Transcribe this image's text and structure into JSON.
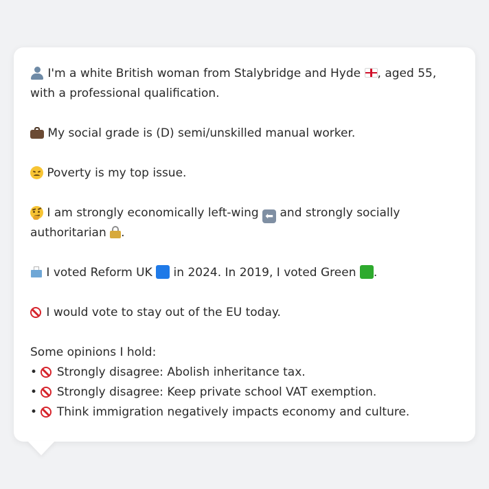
{
  "profile": {
    "intro_pre": "I'm a white British woman from Stalybridge and Hyde",
    "intro_post": ", aged 55, with a professional qualification.",
    "social_grade": "My social grade is (D) semi/unskilled manual worker.",
    "top_issue": "Poverty is my top issue.",
    "ideology_pre": "I am strongly economically left-wing",
    "ideology_mid": " and strongly socially authoritarian",
    "ideology_post": ".",
    "vote_pre": "I voted Reform UK",
    "vote_mid": " in 2024. In 2019, I voted Green",
    "vote_post": ".",
    "eu": "I would vote to stay out of the EU today.",
    "opinions_heading": "Some opinions I hold:",
    "opinions": [
      "Strongly disagree: Abolish inheritance tax.",
      "Strongly disagree: Keep private school VAT exemption.",
      "Think immigration negatively impacts economy and culture."
    ],
    "bullet": "•",
    "left_arrow_glyph": "⬅"
  },
  "icons": {
    "intro": "bust-in-silhouette-icon",
    "flag": "england-flag-icon",
    "grade": "briefcase-icon",
    "issue": "disappointed-face-icon",
    "ideology": "thinking-face-icon",
    "left_arrow": "left-arrow-icon",
    "lock": "lock-icon",
    "ballot": "ballot-box-icon",
    "reform_square": "blue-square-icon",
    "green_square": "green-square-icon",
    "no_entry": "prohibited-icon"
  },
  "colors": {
    "reform": "#1f7ae8",
    "green": "#2eaa2e",
    "prohibited": "#d6242c"
  }
}
